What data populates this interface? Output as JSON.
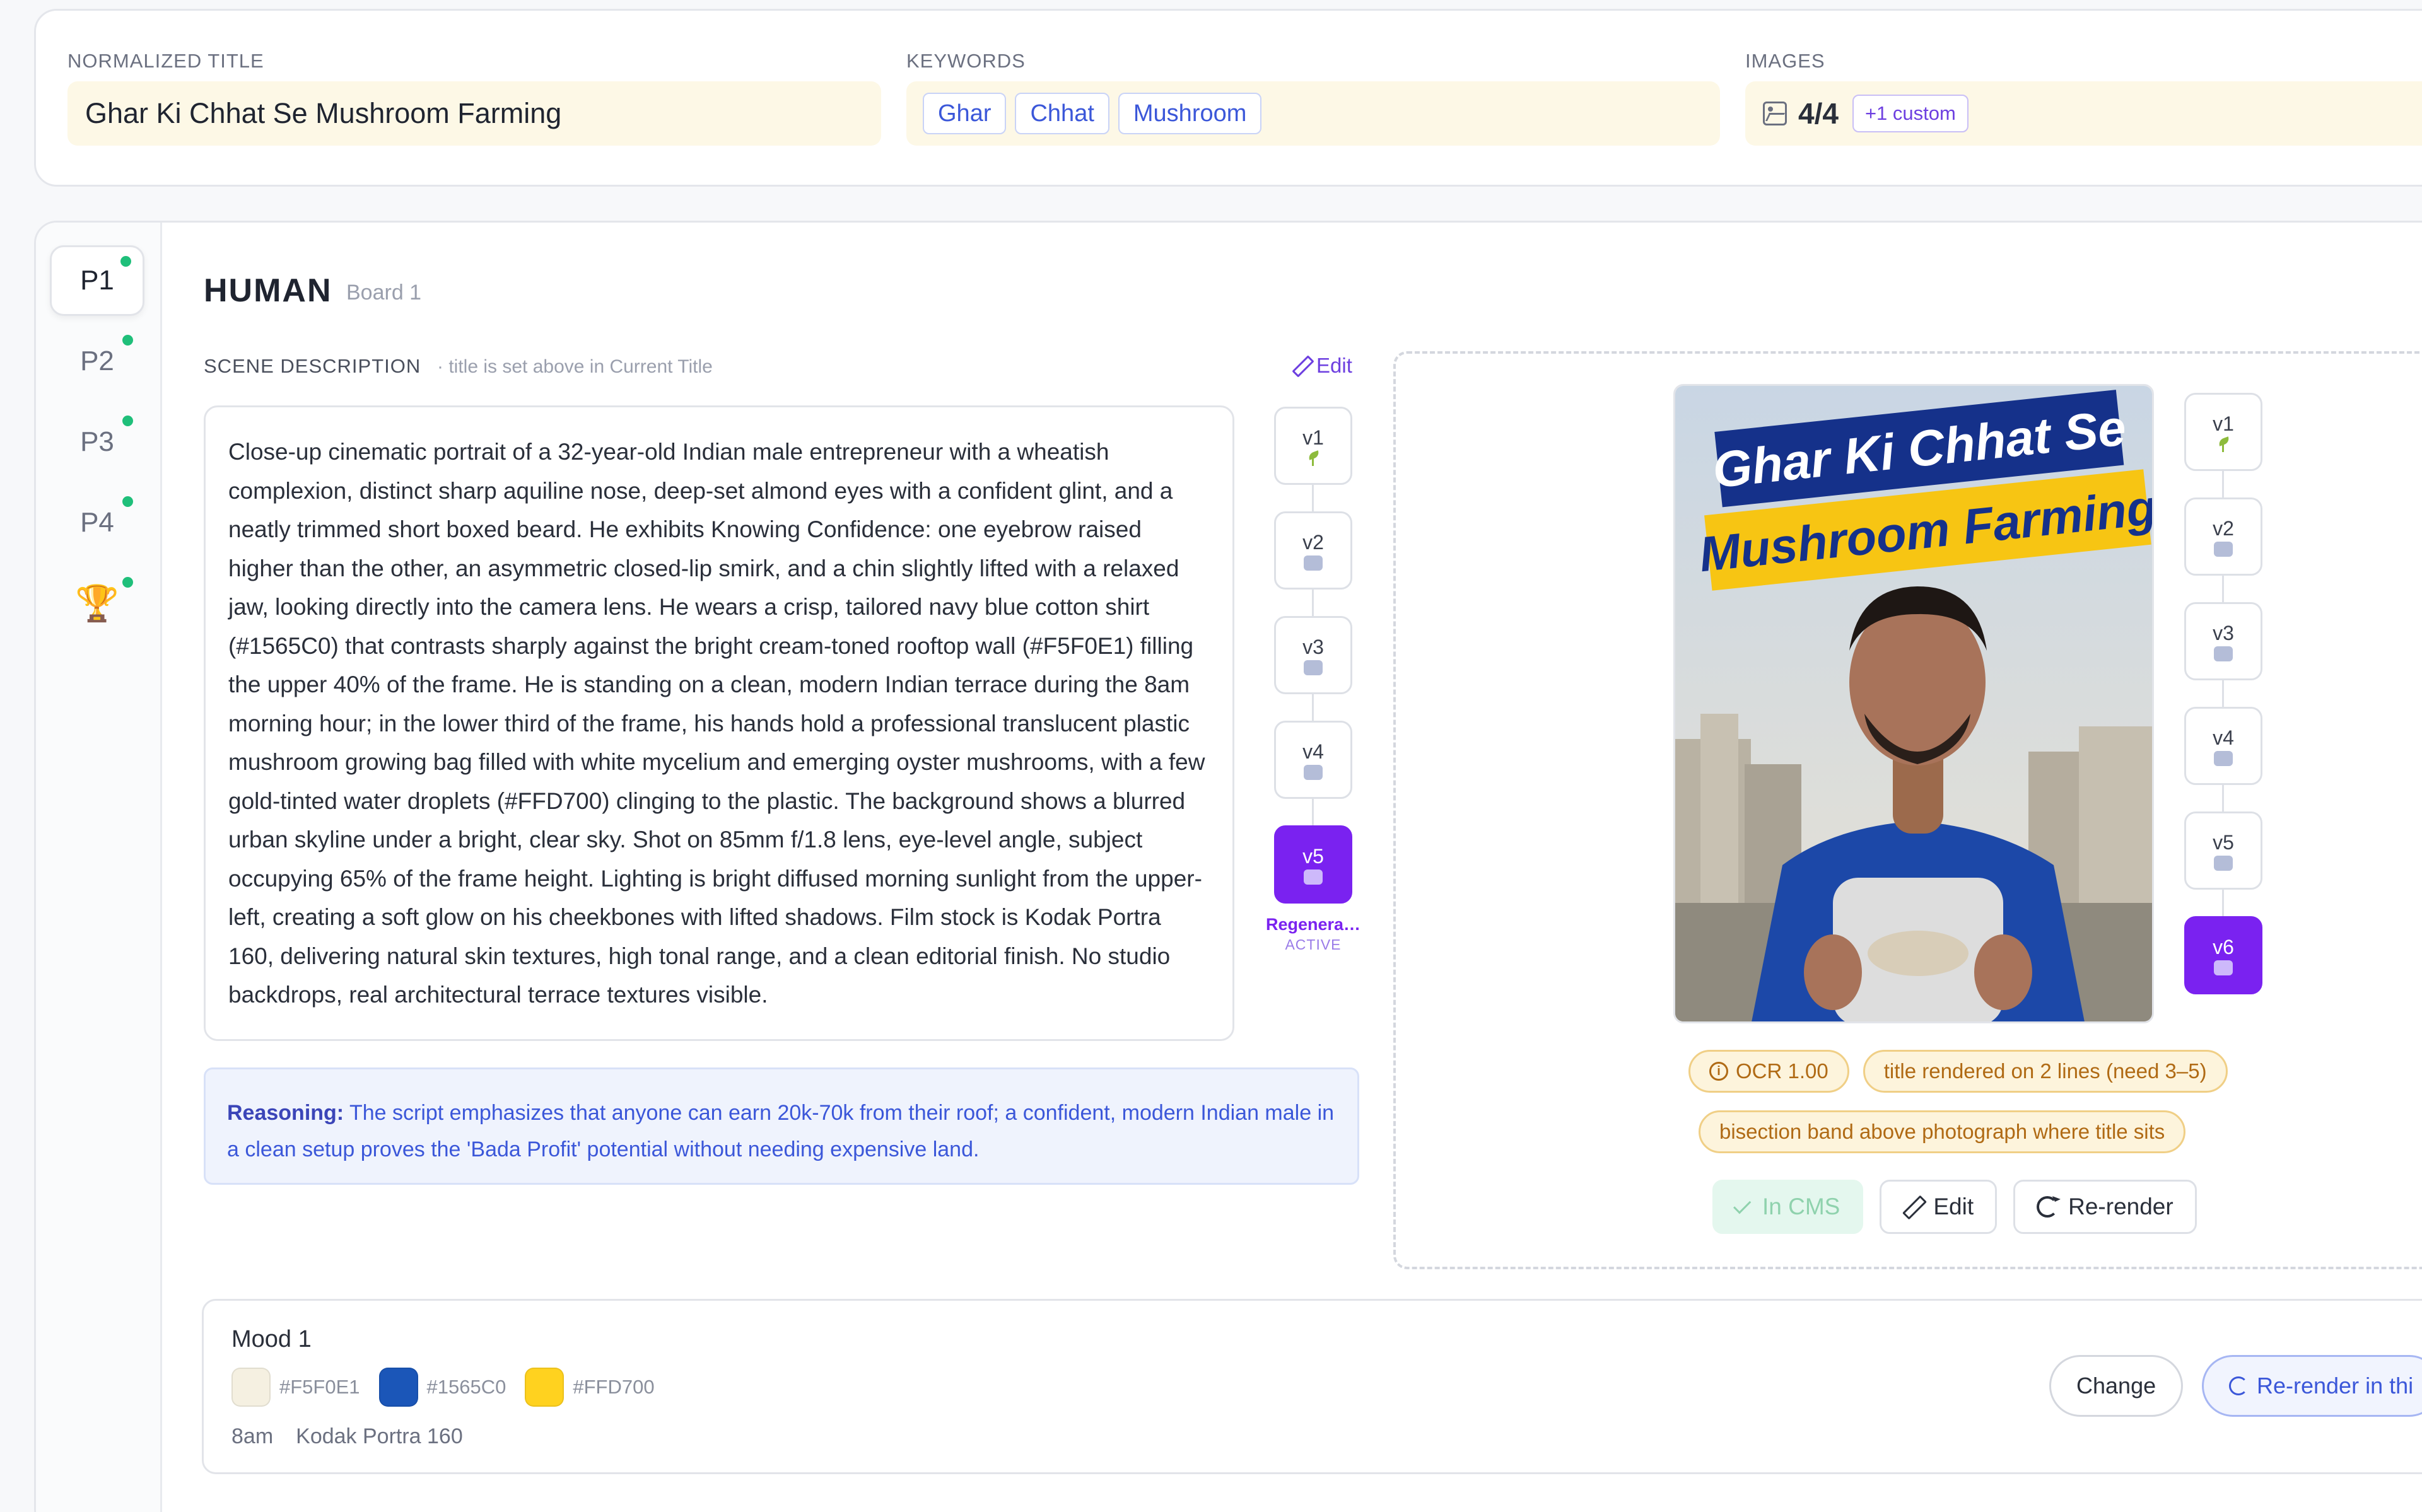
{
  "top": {
    "normalized_title": {
      "label": "NORMALIZED TITLE",
      "value": "Ghar Ki Chhat Se Mushroom Farming"
    },
    "keywords": {
      "label": "KEYWORDS",
      "chips": [
        "Ghar",
        "Chhat",
        "Mushroom"
      ]
    },
    "images": {
      "label": "IMAGES",
      "count": "4/4",
      "custom_chip": "+1 custom",
      "icon": "image-icon"
    }
  },
  "tabs": [
    {
      "label": "P1",
      "active": true
    },
    {
      "label": "P2"
    },
    {
      "label": "P3"
    },
    {
      "label": "P4"
    },
    {
      "label": "🏆",
      "icon": "trophy-icon"
    }
  ],
  "board": {
    "title": "HUMAN",
    "subtitle": "Board 1"
  },
  "scene": {
    "label": "SCENE DESCRIPTION",
    "hint": "· title is set above in Current Title",
    "edit_label": "Edit",
    "text": "Close-up cinematic portrait of a 32-year-old Indian male entrepreneur with a wheatish complexion, distinct sharp aquiline nose, deep-set almond eyes with a confident glint, and a neatly trimmed short boxed beard. He exhibits Knowing Confidence: one eyebrow raised higher than the other, an asymmetric closed-lip smirk, and a chin slightly lifted with a relaxed jaw, looking directly into the camera lens. He wears a crisp, tailored navy blue cotton shirt (#1565C0) that contrasts sharply against the bright cream-toned rooftop wall (#F5F0E1) filling the upper 40% of the frame. He is standing on a clean, modern Indian terrace during the 8am morning hour; in the lower third of the frame, his hands hold a professional translucent plastic mushroom growing bag filled with white mycelium and emerging oyster mushrooms, with a few gold-tinted water droplets (#FFD700) clinging to the plastic. The background shows a blurred urban skyline under a bright, clear sky. Shot on 85mm f/1.8 lens, eye-level angle, subject occupying 65% of the frame height. Lighting is bright diffused morning sunlight from the upper-left, creating a soft glow on his cheekbones with lifted shadows. Film stock is Kodak Portra 160, delivering natural skin textures, high tonal range, and a clean editorial finish. No studio backdrops, real architectural terrace textures visible."
  },
  "prompt_versions": {
    "items": [
      "v1",
      "v2",
      "v3",
      "v4",
      "v5"
    ],
    "active": "v5",
    "active_caption": "Regenera…",
    "active_sub": "ACTIVE"
  },
  "reasoning": {
    "label": "Reasoning:",
    "text": "The script emphasizes that anyone can earn 20k-70k from their roof; a confident, modern Indian male in a clean setup proves the 'Bada Profit' potential without needing expensive land."
  },
  "preview": {
    "thumbnail_line1": "Ghar Ki Chhat Se",
    "thumbnail_line2": "Mushroom Farming",
    "image_versions": [
      "v1",
      "v2",
      "v3",
      "v4",
      "v5",
      "v6"
    ],
    "active_image_version": "v6",
    "badges": {
      "ocr": "OCR 1.00",
      "lines": "title rendered on 2 lines (need 3–5)",
      "band": "bisection band above photograph where title sits"
    },
    "actions": {
      "cms": "In CMS",
      "edit": "Edit",
      "rerender": "Re-render"
    }
  },
  "mood": {
    "title": "Mood 1",
    "swatches": [
      {
        "hex": "#F5F0E1",
        "label": "#F5F0E1"
      },
      {
        "hex": "#1565C0",
        "label": "#1565C0"
      },
      {
        "hex": "#FFD700",
        "label": "#FFD700"
      }
    ],
    "time": "8am",
    "film": "Kodak Portra 160",
    "change_label": "Change",
    "rerender_label": "Re-render in thi"
  }
}
